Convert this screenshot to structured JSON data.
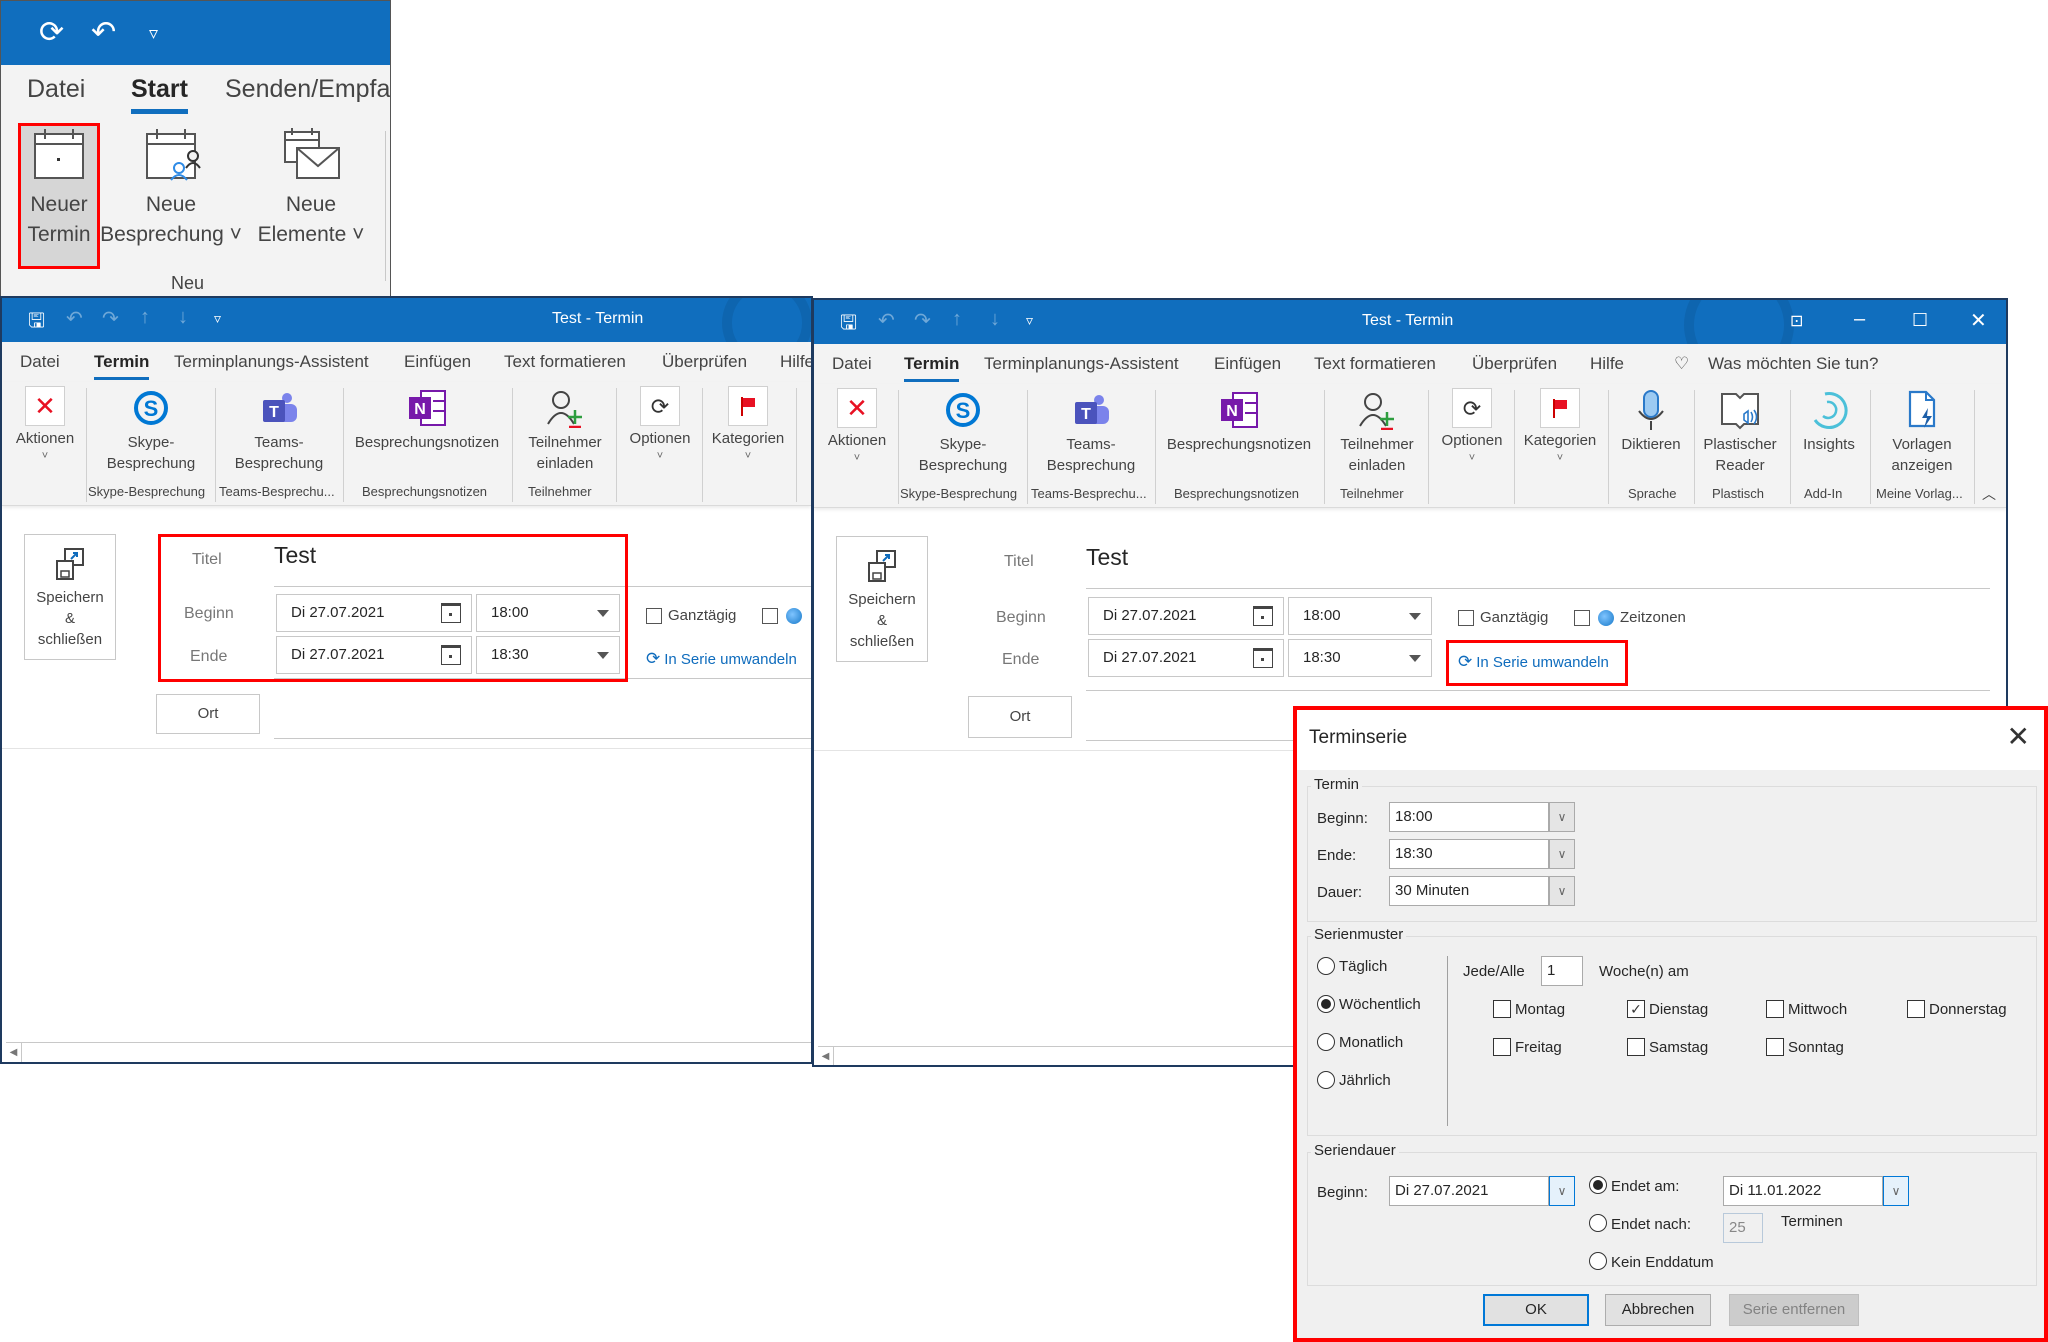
{
  "snippet": {
    "qat": {
      "sync_icon": "sync-icon",
      "undo_icon": "undo-icon",
      "customize_icon": "customize-qat-icon"
    },
    "tabs": [
      "Datei",
      "Start",
      "Senden/Empfa"
    ],
    "active_tab": "Start",
    "buttons": [
      {
        "line1": "Neuer",
        "line2": "Termin",
        "icon": "calendar-icon",
        "highlighted": true
      },
      {
        "line1": "Neue",
        "line2": "Besprechung ˅",
        "icon": "calendar-people-icon",
        "highlighted": false
      },
      {
        "line1": "Neue",
        "line2": "Elemente ˅",
        "icon": "calendar-mail-icon",
        "highlighted": false
      }
    ],
    "group_label": "Neu"
  },
  "window_left": {
    "title": "Test  -  Termin",
    "tabs": [
      "Datei",
      "Termin",
      "Terminplanungs-Assistent",
      "Einfügen",
      "Text formatieren",
      "Überprüfen",
      "Hilfe"
    ],
    "active_tab": "Termin",
    "ribbon": {
      "buttons": [
        {
          "line1": "Aktionen",
          "line2": "˅",
          "icon": "delete-x-icon"
        },
        {
          "line1": "Skype-",
          "line2": "Besprechung",
          "icon": "skype-icon"
        },
        {
          "line1": "Teams-",
          "line2": "Besprechung",
          "icon": "teams-icon"
        },
        {
          "line1": "Besprechungsnotizen",
          "line2": "",
          "icon": "onenote-icon"
        },
        {
          "line1": "Teilnehmer",
          "line2": "einladen",
          "icon": "invite-attendee-icon"
        },
        {
          "line1": "Optionen",
          "line2": "˅",
          "icon": "options-sync-icon"
        },
        {
          "line1": "Kategorien",
          "line2": "˅",
          "icon": "category-flag-icon"
        }
      ],
      "groups": [
        "Skype-Besprechung",
        "Teams-Besprechu...",
        "Besprechungsnotizen",
        "Teilnehmer"
      ]
    },
    "form": {
      "save_close": {
        "line1": "Speichern",
        "line2": "&",
        "line3": "schließen"
      },
      "title_label": "Titel",
      "title_value": "Test",
      "start_label": "Beginn",
      "start_date": "Di 27.07.2021",
      "start_time": "18:00",
      "end_label": "Ende",
      "end_date": "Di 27.07.2021",
      "end_time": "18:30",
      "all_day_label": "Ganztägig",
      "all_day_checked": false,
      "timezones_checked": false,
      "recurrence_link": "In Serie umwandeln",
      "location_button": "Ort",
      "location_value": ""
    }
  },
  "window_right": {
    "title": "Test  -  Termin",
    "tabs": [
      "Datei",
      "Termin",
      "Terminplanungs-Assistent",
      "Einfügen",
      "Text formatieren",
      "Überprüfen",
      "Hilfe"
    ],
    "active_tab": "Termin",
    "tell_me": "Was möchten Sie tun?",
    "ribbon": {
      "buttons": [
        {
          "line1": "Aktionen",
          "line2": "˅",
          "icon": "delete-x-icon"
        },
        {
          "line1": "Skype-",
          "line2": "Besprechung",
          "icon": "skype-icon"
        },
        {
          "line1": "Teams-",
          "line2": "Besprechung",
          "icon": "teams-icon"
        },
        {
          "line1": "Besprechungsnotizen",
          "line2": "",
          "icon": "onenote-icon"
        },
        {
          "line1": "Teilnehmer",
          "line2": "einladen",
          "icon": "invite-attendee-icon"
        },
        {
          "line1": "Optionen",
          "line2": "˅",
          "icon": "options-sync-icon"
        },
        {
          "line1": "Kategorien",
          "line2": "˅",
          "icon": "category-flag-icon"
        },
        {
          "line1": "Diktieren",
          "line2": "",
          "icon": "microphone-icon"
        },
        {
          "line1": "Plastischer",
          "line2": "Reader",
          "icon": "immersive-reader-icon"
        },
        {
          "line1": "Insights",
          "line2": "",
          "icon": "insights-icon"
        },
        {
          "line1": "Vorlagen",
          "line2": "anzeigen",
          "icon": "templates-icon"
        }
      ],
      "groups": [
        "Skype-Besprechung",
        "Teams-Besprechu...",
        "Besprechungsnotizen",
        "Teilnehmer",
        "Sprache",
        "Plastisch",
        "Add-In",
        "Meine Vorlag..."
      ]
    },
    "form": {
      "save_close": {
        "line1": "Speichern",
        "line2": "&",
        "line3": "schließen"
      },
      "title_label": "Titel",
      "title_value": "Test",
      "start_label": "Beginn",
      "start_date": "Di 27.07.2021",
      "start_time": "18:00",
      "end_label": "Ende",
      "end_date": "Di 27.07.2021",
      "end_time": "18:30",
      "all_day_label": "Ganztägig",
      "all_day_checked": false,
      "timezones_label": "Zeitzonen",
      "timezones_checked": false,
      "recurrence_link": "In Serie umwandeln",
      "location_button": "Ort",
      "location_value": ""
    }
  },
  "dialog": {
    "title": "Terminserie",
    "appointment": {
      "group_title": "Termin",
      "start_label": "Beginn:",
      "start_value": "18:00",
      "end_label": "Ende:",
      "end_value": "18:30",
      "duration_label": "Dauer:",
      "duration_value": "30 Minuten"
    },
    "pattern": {
      "group_title": "Serienmuster",
      "options": [
        {
          "label": "Täglich",
          "selected": false
        },
        {
          "label": "Wöchentlich",
          "selected": true
        },
        {
          "label": "Monatlich",
          "selected": false
        },
        {
          "label": "Jährlich",
          "selected": false
        }
      ],
      "every_label": "Jede/Alle",
      "every_value": "1",
      "weeks_label": "Woche(n) am",
      "days": [
        {
          "label": "Montag",
          "checked": false
        },
        {
          "label": "Dienstag",
          "checked": true
        },
        {
          "label": "Mittwoch",
          "checked": false
        },
        {
          "label": "Donnerstag",
          "checked": false
        },
        {
          "label": "Freitag",
          "checked": false
        },
        {
          "label": "Samstag",
          "checked": false
        },
        {
          "label": "Sonntag",
          "checked": false
        }
      ]
    },
    "range": {
      "group_title": "Seriendauer",
      "start_label": "Beginn:",
      "start_value": "Di 27.07.2021",
      "end_by_label": "Endet am:",
      "end_by_value": "Di 11.01.2022",
      "end_by_selected": true,
      "end_after_label": "Endet nach:",
      "end_after_value": "25",
      "end_after_suffix": "Terminen",
      "end_after_selected": false,
      "no_end_label": "Kein Enddatum",
      "no_end_selected": false
    },
    "buttons": {
      "ok": "OK",
      "cancel": "Abbrechen",
      "remove": "Serie entfernen"
    }
  },
  "colors": {
    "accent": "#106ebe",
    "highlight": "#ff0000",
    "link": "#0f6cbd"
  }
}
